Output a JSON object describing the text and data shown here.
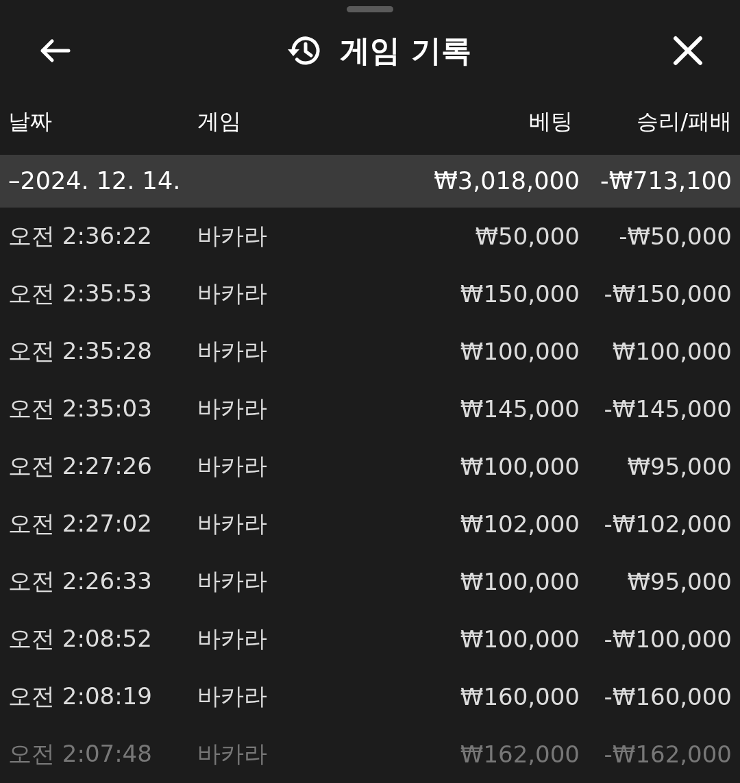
{
  "header": {
    "title": "게임 기록"
  },
  "columns": [
    "날짜",
    "게임",
    "베팅",
    "승리/패배"
  ],
  "group": {
    "date": "–2024. 12. 14.",
    "bet": "₩3,018,000",
    "result": "-₩713,100"
  },
  "rows": [
    {
      "time": "오전 2:36:22",
      "game": "바카라",
      "bet": "₩50,000",
      "result": "-₩50,000",
      "faded": false
    },
    {
      "time": "오전 2:35:53",
      "game": "바카라",
      "bet": "₩150,000",
      "result": "-₩150,000",
      "faded": false
    },
    {
      "time": "오전 2:35:28",
      "game": "바카라",
      "bet": "₩100,000",
      "result": "₩100,000",
      "faded": false
    },
    {
      "time": "오전 2:35:03",
      "game": "바카라",
      "bet": "₩145,000",
      "result": "-₩145,000",
      "faded": false
    },
    {
      "time": "오전 2:27:26",
      "game": "바카라",
      "bet": "₩100,000",
      "result": "₩95,000",
      "faded": false
    },
    {
      "time": "오전 2:27:02",
      "game": "바카라",
      "bet": "₩102,000",
      "result": "-₩102,000",
      "faded": false
    },
    {
      "time": "오전 2:26:33",
      "game": "바카라",
      "bet": "₩100,000",
      "result": "₩95,000",
      "faded": false
    },
    {
      "time": "오전 2:08:52",
      "game": "바카라",
      "bet": "₩100,000",
      "result": "-₩100,000",
      "faded": false
    },
    {
      "time": "오전 2:08:19",
      "game": "바카라",
      "bet": "₩160,000",
      "result": "-₩160,000",
      "faded": false
    },
    {
      "time": "오전 2:07:48",
      "game": "바카라",
      "bet": "₩162,000",
      "result": "-₩162,000",
      "faded": true
    }
  ]
}
